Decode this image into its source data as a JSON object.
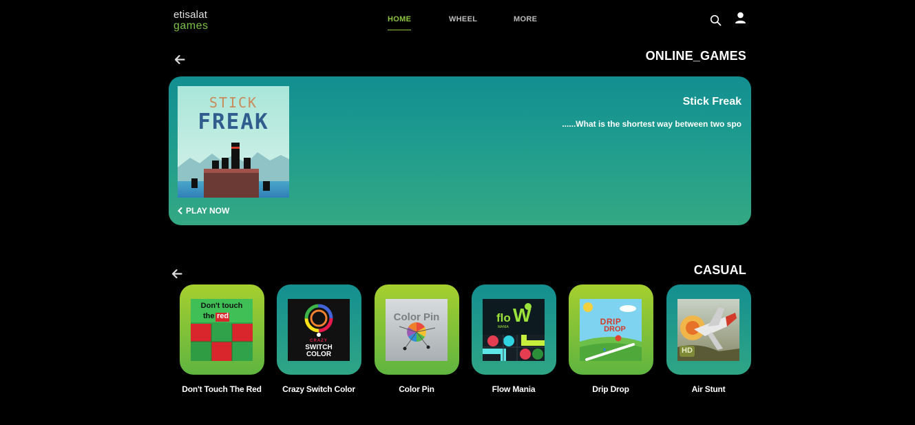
{
  "header": {
    "logo_line1": "etisalat",
    "logo_line2": "games",
    "nav": [
      {
        "label": "HOME",
        "active": true
      },
      {
        "label": "WHEEL",
        "active": false
      },
      {
        "label": "MORE",
        "active": false
      }
    ],
    "icons": [
      "search-icon",
      "user-icon"
    ]
  },
  "online_games": {
    "title": "ONLINE_GAMES",
    "featured": {
      "title": "Stick Freak",
      "description": "......What is the shortest way between two spo",
      "play_label": "PLAY NOW",
      "thumb_text_top": "STICK",
      "thumb_text_bottom": "FREAK"
    }
  },
  "casual": {
    "title": "CASUAL",
    "games": [
      {
        "name": "Don't Touch The Red",
        "thumb_text": [
          "Don't touch",
          "the",
          "red"
        ]
      },
      {
        "name": "Crazy Switch Color",
        "thumb_text": [
          "CRAZY",
          "SWITCH",
          "COLOR"
        ]
      },
      {
        "name": "Color Pin",
        "thumb_text": [
          "Color Pin"
        ]
      },
      {
        "name": "Flow Mania",
        "thumb_text": [
          "flo",
          "W",
          "MANIA"
        ]
      },
      {
        "name": "Drip Drop",
        "thumb_text": [
          "DRIP",
          "DROP"
        ]
      },
      {
        "name": "Air Stunt",
        "thumb_text": [
          "HD"
        ]
      }
    ]
  },
  "colors": {
    "accent": "#8dc63f",
    "banner_top": "#128e91",
    "banner_bottom": "#34a883",
    "card_green": "#a6cf2f",
    "card_teal": "#148f90"
  }
}
